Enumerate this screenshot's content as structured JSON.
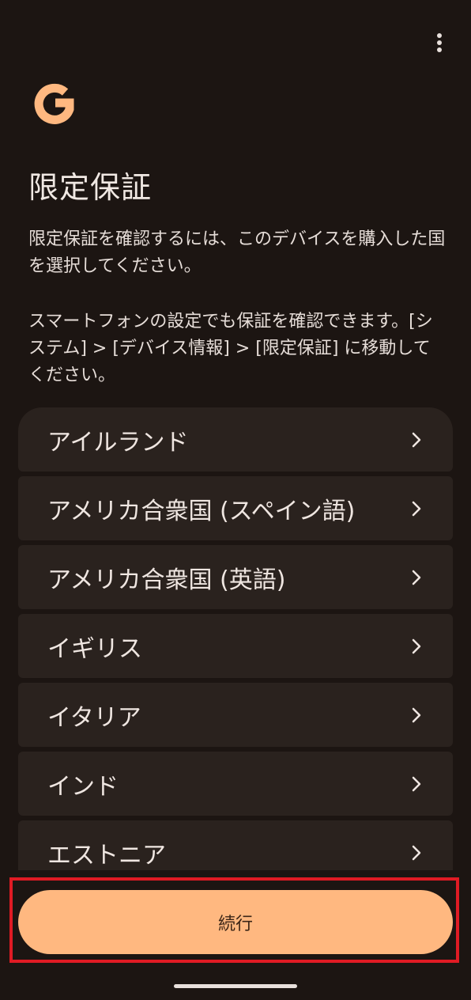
{
  "header": {
    "menu_icon": "more-vert-icon",
    "logo_icon": "google-g-logo",
    "title": "限定保証"
  },
  "description": {
    "paragraph1": "限定保証を確認するには、このデバイスを購入した国を選択してください。",
    "paragraph2": "スマートフォンの設定でも保証を確認できます。[システム] > [デバイス情報] > [限定保証] に移動してください。"
  },
  "countries": [
    {
      "label": "アイルランド"
    },
    {
      "label": "アメリカ合衆国 (スペイン語)"
    },
    {
      "label": "アメリカ合衆国 (英語)"
    },
    {
      "label": "イギリス"
    },
    {
      "label": "イタリア"
    },
    {
      "label": "インド"
    },
    {
      "label": "エストニア"
    }
  ],
  "footer": {
    "continue_label": "続行"
  },
  "colors": {
    "background": "#1c1512",
    "item_background": "#2a221e",
    "accent": "#ffb880",
    "highlight_border": "#e01b24"
  }
}
